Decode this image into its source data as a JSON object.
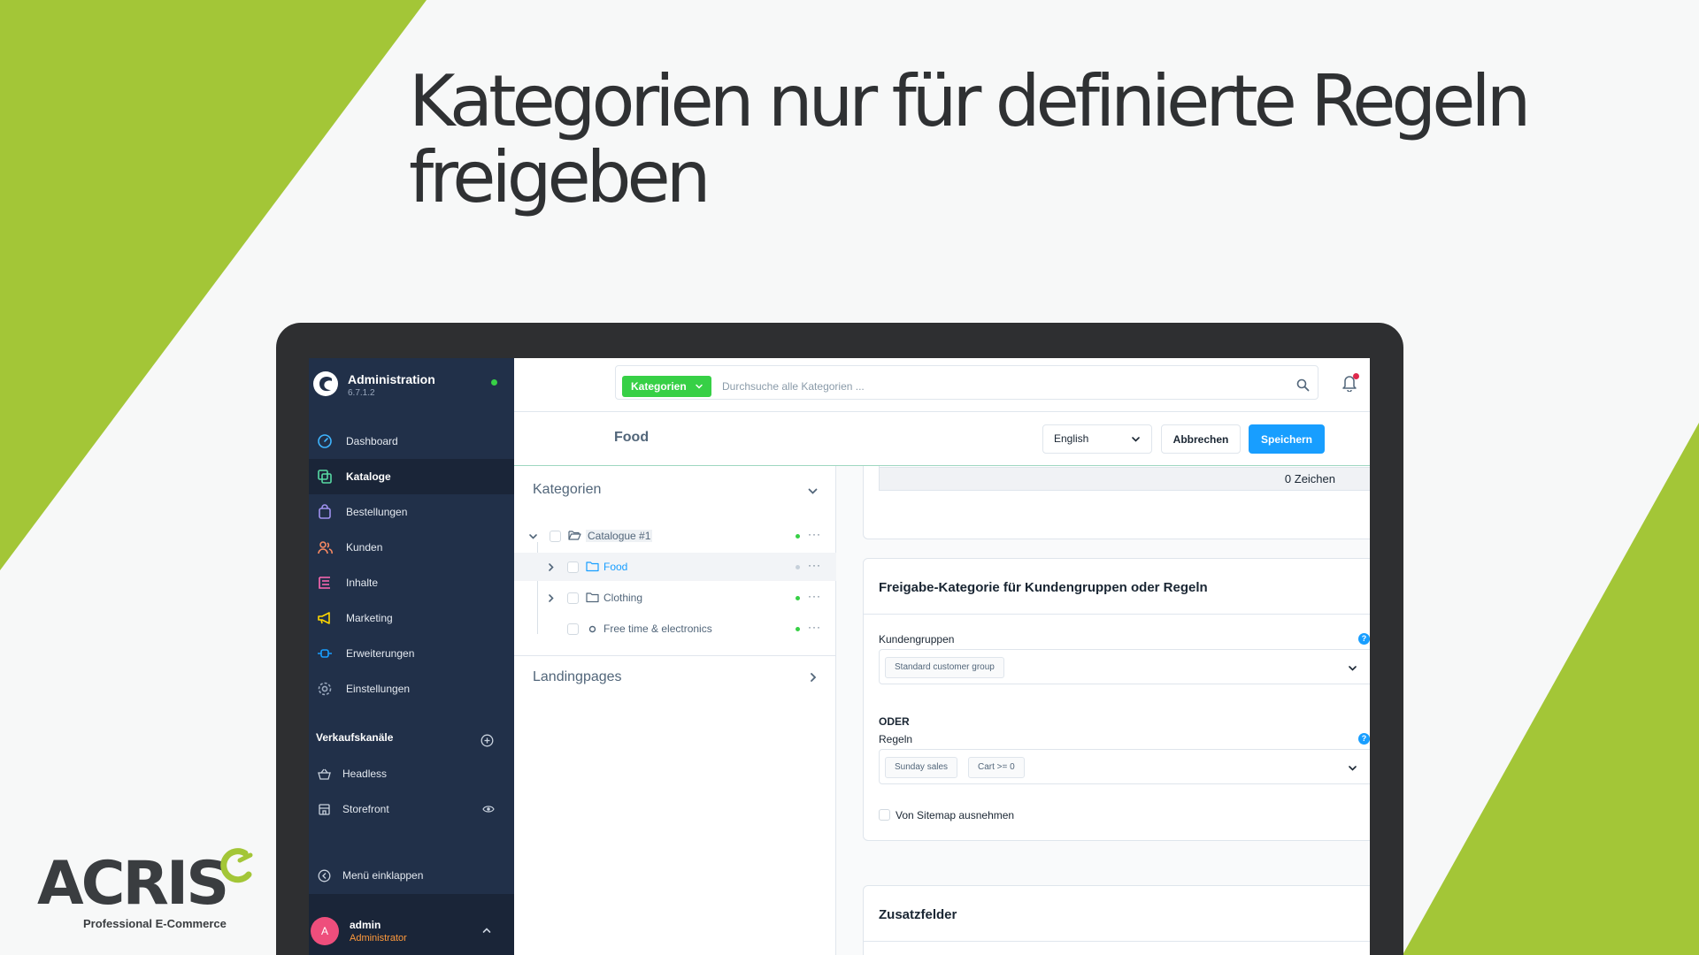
{
  "headline": {
    "line1": "Kategorien nur für definierte Regeln",
    "line2": "freigeben"
  },
  "colors": {
    "brand_green": "#a3c637",
    "sidebar_bg": "#213049",
    "primary_blue": "#189eff",
    "status_green": "#37d046"
  },
  "logo": {
    "word": "ACRIS",
    "tagline": "Professional E-Commerce"
  },
  "sidebar": {
    "app_title": "Administration",
    "version": "6.7.1.2",
    "nav": [
      {
        "label": "Dashboard",
        "icon": "gauge-icon",
        "active": false
      },
      {
        "label": "Kataloge",
        "icon": "catalog-icon",
        "active": true
      },
      {
        "label": "Bestellungen",
        "icon": "shopping-bag-icon",
        "active": false
      },
      {
        "label": "Kunden",
        "icon": "users-icon",
        "active": false
      },
      {
        "label": "Inhalte",
        "icon": "content-icon",
        "active": false
      },
      {
        "label": "Marketing",
        "icon": "megaphone-icon",
        "active": false
      },
      {
        "label": "Erweiterungen",
        "icon": "plug-icon",
        "active": false
      },
      {
        "label": "Einstellungen",
        "icon": "gear-icon",
        "active": false
      }
    ],
    "sales_channels_title": "Verkaufskanäle",
    "sales_channels": [
      {
        "label": "Headless",
        "icon": "basket-icon"
      },
      {
        "label": "Storefront",
        "icon": "storefront-icon"
      }
    ],
    "collapse_label": "Menü einklappen",
    "user": {
      "initial": "A",
      "name": "admin",
      "role": "Administrator"
    }
  },
  "topbar": {
    "search_type": "Kategorien",
    "search_placeholder": "Durchsuche alle Kategorien ..."
  },
  "titlebar": {
    "title": "Food",
    "language": "English",
    "cancel_label": "Abbrechen",
    "save_label": "Speichern"
  },
  "tree": {
    "heading": "Kategorien",
    "rows": [
      {
        "label": "Catalogue #1",
        "level": 0,
        "expanded": true,
        "status": "active"
      },
      {
        "label": "Food",
        "level": 1,
        "expanded": false,
        "status": "inactive",
        "selected": true
      },
      {
        "label": "Clothing",
        "level": 1,
        "expanded": false,
        "status": "active"
      },
      {
        "label": "Free time & electronics",
        "level": 1,
        "leaf": true,
        "status": "active"
      }
    ],
    "more_label": "···",
    "landingpages_heading": "Landingpages"
  },
  "content": {
    "char_count": "0 Zeichen",
    "visibility_card": {
      "title": "Freigabe-Kategorie für Kundengruppen oder Regeln",
      "customer_groups_label": "Kundengruppen",
      "customer_groups": [
        "Standard customer group"
      ],
      "or_label": "ODER",
      "rules_label": "Regeln",
      "rules": [
        "Sunday sales",
        "Cart >= 0"
      ],
      "sitemap_label": "Von Sitemap ausnehmen",
      "help_glyph": "?"
    },
    "extra_fields_title": "Zusatzfelder"
  }
}
